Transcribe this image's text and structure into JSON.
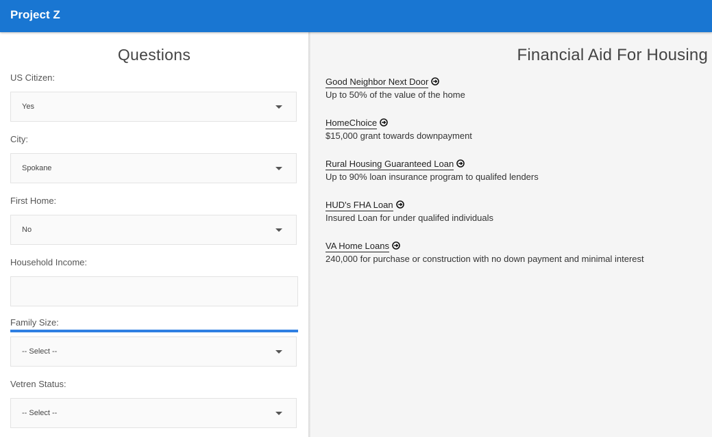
{
  "header": {
    "title": "Project Z"
  },
  "questions": {
    "title": "Questions",
    "us_citizen": {
      "label": "US Citizen:",
      "value": "Yes"
    },
    "city": {
      "label": "City:",
      "value": "Spokane"
    },
    "first_home": {
      "label": "First Home:",
      "value": "No"
    },
    "household_income": {
      "label": "Household Income:",
      "value": "",
      "placeholder": ""
    },
    "family_size": {
      "label": "Family Size:",
      "value": "-- Select --"
    },
    "vetren_status": {
      "label": "Vetren Status:",
      "value": "-- Select --"
    }
  },
  "aid": {
    "title": "Financial Aid For Housing",
    "items": [
      {
        "name": "Good Neighbor Next Door",
        "desc": "Up to 50% of the value of the home",
        "icon": "arrow-right-circle-icon"
      },
      {
        "name": "HomeChoice",
        "desc": "$15,000 grant towards downpayment",
        "icon": "arrow-right-circle-icon"
      },
      {
        "name": "Rural Housing Guaranteed Loan",
        "desc": "Up to 90% loan insurance program to qualifed lenders",
        "icon": "arrow-right-circle-icon"
      },
      {
        "name": "HUD's FHA Loan",
        "desc": "Insured Loan for under qualifed individuals",
        "icon": "arrow-right-circle-icon"
      },
      {
        "name": "VA Home Loans",
        "desc": "240,000 for purchase or construction with no down payment and minimal interest",
        "icon": "arrow-right-circle-icon"
      }
    ]
  },
  "colors": {
    "header": "#1976d2",
    "focus": "#2f7fe2",
    "panel_bg": "#f5f5f5"
  }
}
